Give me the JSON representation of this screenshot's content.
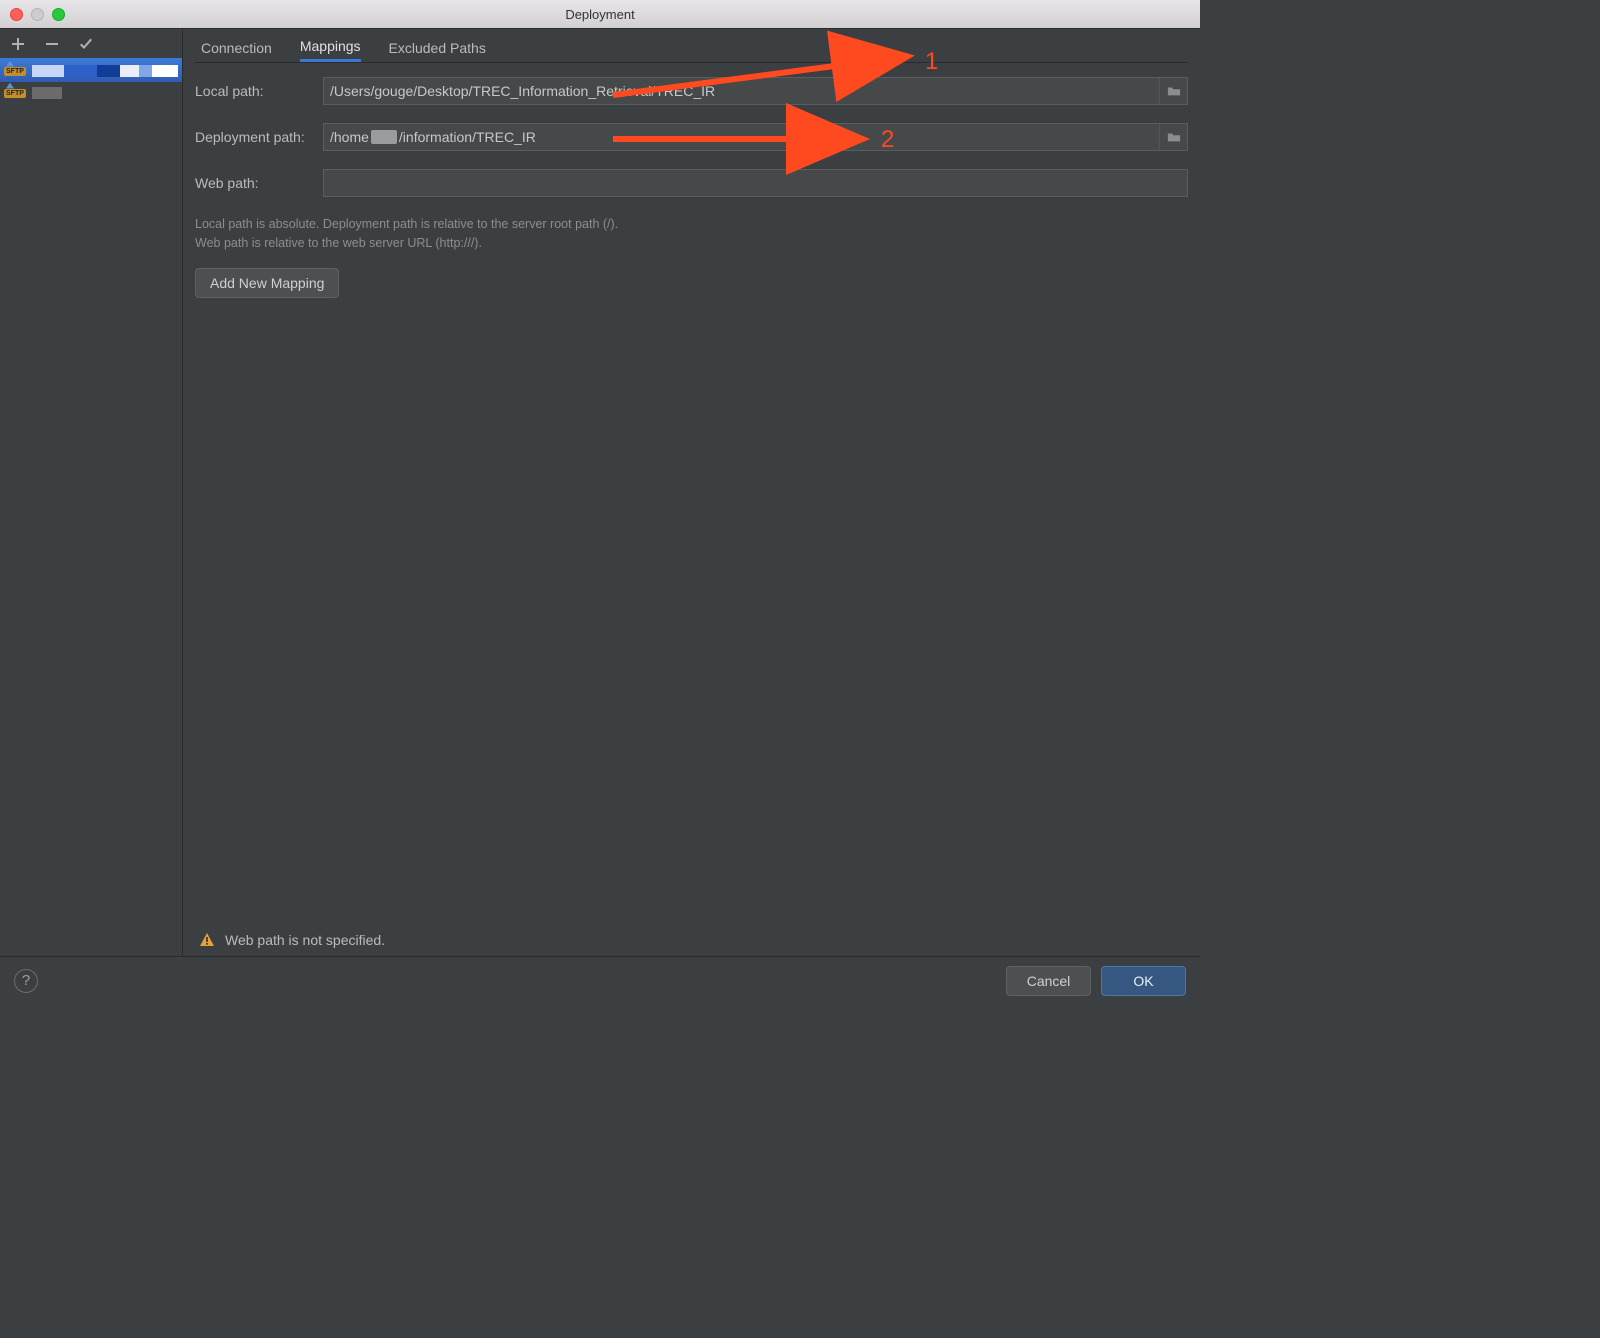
{
  "window": {
    "title": "Deployment"
  },
  "sidebar": {
    "toolbar": {
      "add_tooltip": "Add",
      "remove_tooltip": "Remove",
      "apply_tooltip": "Apply"
    },
    "servers": [
      {
        "badge": "SFTP",
        "selected": true
      },
      {
        "badge": "SFTP",
        "selected": false
      }
    ]
  },
  "tabs": [
    {
      "id": "connection",
      "label": "Connection",
      "active": false
    },
    {
      "id": "mappings",
      "label": "Mappings",
      "active": true
    },
    {
      "id": "excluded",
      "label": "Excluded Paths",
      "active": false
    }
  ],
  "form": {
    "local_path": {
      "label": "Local path:",
      "value": "/Users/gouge/Desktop/TREC_Information_Retrieval/TREC_IR"
    },
    "deployment_path": {
      "label": "Deployment path:",
      "value_prefix": "/home",
      "value_suffix": "/information/TREC_IR"
    },
    "web_path": {
      "label": "Web path:",
      "value": ""
    },
    "help_line1": "Local path is absolute. Deployment path is relative to the server root path (/).",
    "help_line2": "Web path is relative to the web server URL (http:///).",
    "add_mapping_label": "Add New Mapping"
  },
  "warning": {
    "text": "Web path is not specified."
  },
  "buttons": {
    "cancel": "Cancel",
    "ok": "OK"
  },
  "annotations": {
    "one": "1",
    "two": "2"
  }
}
